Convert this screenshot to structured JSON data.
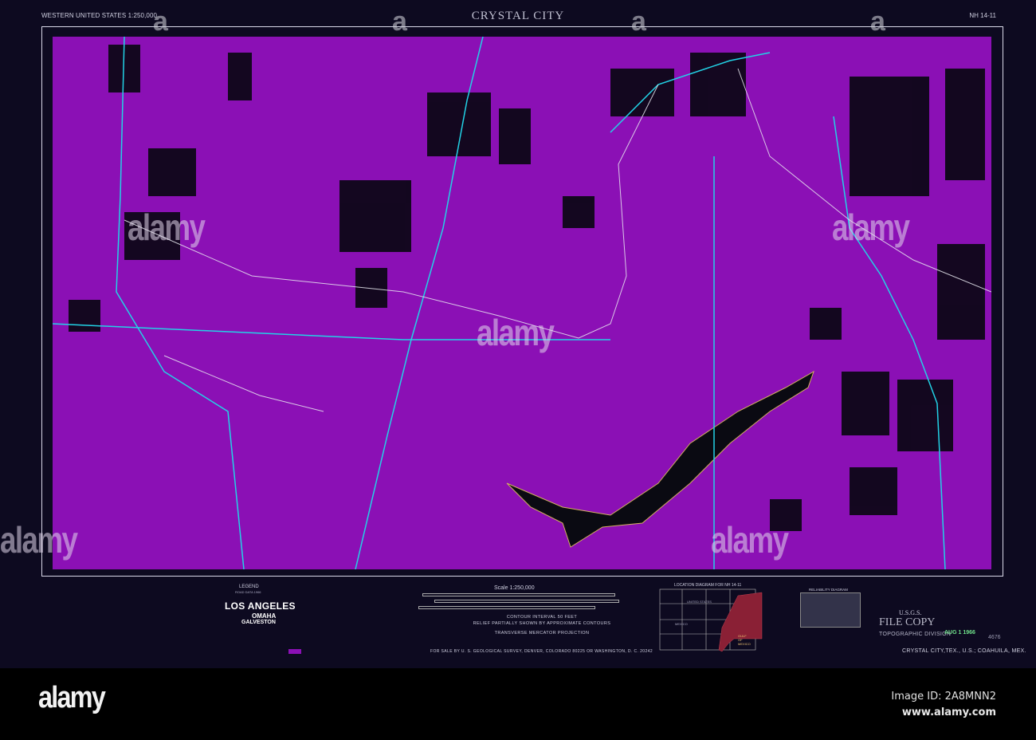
{
  "header": {
    "series": "WESTERN UNITED STATES 1:250,000",
    "title": "CRYSTAL CITY",
    "sheet_id": "NH 14-11"
  },
  "legend": {
    "title": "LEGEND",
    "subtitle": "ROAD DATA 1966",
    "places": [
      "LOS ANGELES",
      "OMAHA",
      "GALVESTON"
    ],
    "colors": {
      "water_features": "#8b10b5",
      "highways": "#22d3e6",
      "woodland": "#000000"
    }
  },
  "scale": {
    "title": "Scale 1:250,000",
    "contour": "CONTOUR INTERVAL 50 FEET",
    "relief": "RELIEF PARTIALLY SHOWN BY APPROXIMATE CONTOURS",
    "projection": "TRANSVERSE MERCATOR PROJECTION",
    "for_sale": "FOR SALE BY U. S. GEOLOGICAL SURVEY, DENVER, COLORADO 80225 OR WASHINGTON, D. C. 20242"
  },
  "location_diagram": {
    "title": "LOCATION DIAGRAM FOR NH 14-11",
    "labels": [
      "UNITED STATES",
      "MEXICO",
      "GULF OF MEXICO"
    ]
  },
  "reliability_diagram": {
    "title": "RELIABILITY DIAGRAM"
  },
  "stamp": {
    "usgs": "U.S.G.S.",
    "file_copy": "FILE COPY",
    "division": "TOPOGRAPHIC DIVISION",
    "date": "AUG 1 1966",
    "number": "4676"
  },
  "footer_caption": "CRYSTAL CITY,TEX., U.S.; COAHUILA, MEX.",
  "watermark": {
    "logo": "alamy",
    "image_id": "Image ID: 2A8MNN2",
    "url": "www.alamy.com"
  }
}
